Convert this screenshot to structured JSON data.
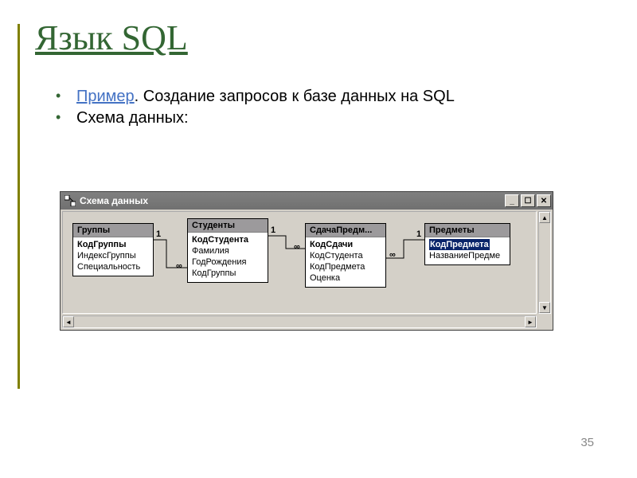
{
  "title": "Язык SQL",
  "bullets": {
    "line1_link": "Пример",
    "line1_rest": ". Создание запросов к базе данных на SQL",
    "line2": "Схема данных:"
  },
  "window": {
    "title": "Схема данных"
  },
  "tables": [
    {
      "name": "Группы",
      "fields": [
        "КодГруппы",
        "ИндексГруппы",
        "Специальность"
      ],
      "pk_index": 0
    },
    {
      "name": "Студенты",
      "fields": [
        "КодСтудента",
        "Фамилия",
        "ГодРождения",
        "КодГруппы"
      ],
      "pk_index": 0
    },
    {
      "name": "СдачаПредм...",
      "fields": [
        "КодСдачи",
        "КодСтудента",
        "КодПредмета",
        "Оценка"
      ],
      "pk_index": 0
    },
    {
      "name": "Предметы",
      "fields": [
        "КодПредмета",
        "НазваниеПредме"
      ],
      "pk_index": 0,
      "selected": 0
    }
  ],
  "relations": {
    "one": "1",
    "many": "∞"
  },
  "page_number": "35"
}
